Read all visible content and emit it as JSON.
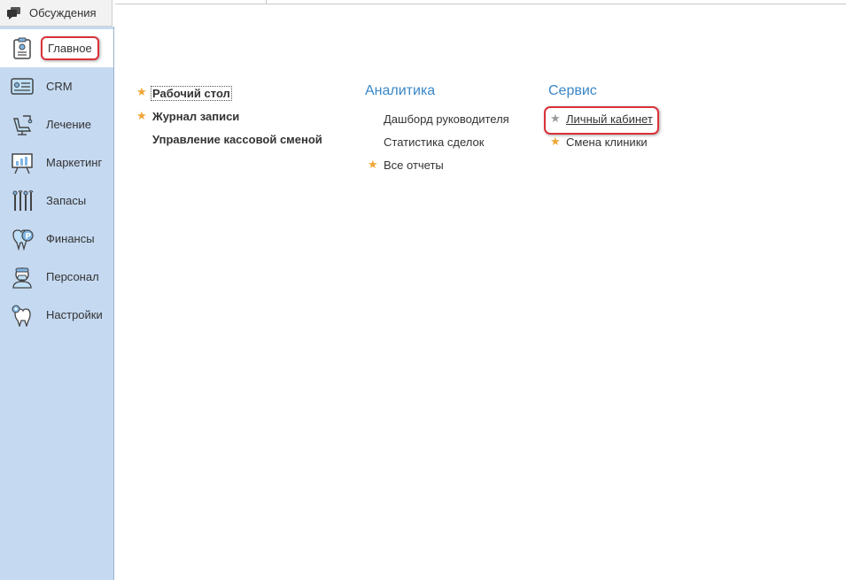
{
  "topbar": {
    "discussions_label": "Обсуждения",
    "icon": "chat-bubbles-icon"
  },
  "sidebar": {
    "items": [
      {
        "label": "Главное",
        "icon": "home-clipboard-icon",
        "active": true
      },
      {
        "label": "CRM",
        "icon": "crm-card-icon"
      },
      {
        "label": "Лечение",
        "icon": "dental-chair-icon"
      },
      {
        "label": "Маркетинг",
        "icon": "presentation-board-icon"
      },
      {
        "label": "Запасы",
        "icon": "dental-tools-icon"
      },
      {
        "label": "Финансы",
        "icon": "tooth-coin-icon"
      },
      {
        "label": "Персонал",
        "icon": "doctor-icon"
      },
      {
        "label": "Настройки",
        "icon": "tooth-gear-icon"
      }
    ]
  },
  "main": {
    "col1": {
      "links": [
        {
          "label": "Рабочий стол",
          "starred": true
        },
        {
          "label": "Журнал записи",
          "starred": true
        },
        {
          "label": "Управление кассовой сменой",
          "starred": false
        }
      ]
    },
    "col2": {
      "title": "Аналитика",
      "links": [
        {
          "label": "Дашборд руководителя",
          "starred": false
        },
        {
          "label": "Статистика сделок",
          "starred": false
        },
        {
          "label": "Все отчеты",
          "starred": true
        }
      ]
    },
    "col3": {
      "title": "Сервис",
      "links": [
        {
          "label": "Личный кабинет",
          "starred": false
        },
        {
          "label": "Смена клиники",
          "starred": true
        }
      ]
    }
  },
  "colors": {
    "accent": "#3a87c8",
    "star": "#f0a536",
    "sidebar_bg": "#c5d9f1",
    "highlight": "#d9323a"
  }
}
